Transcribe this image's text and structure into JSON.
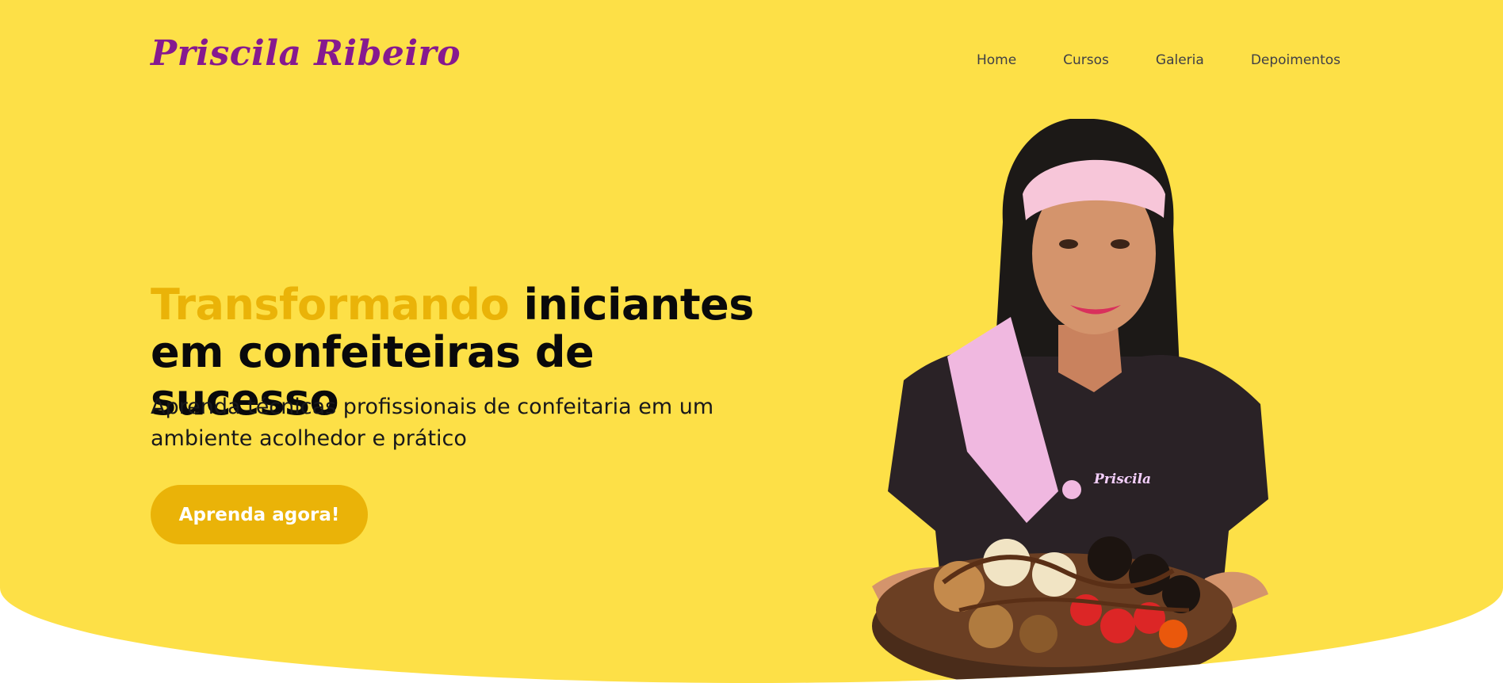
{
  "header": {
    "logo_text": "Priscila Ribeiro",
    "nav": [
      {
        "label": "Home"
      },
      {
        "label": "Cursos"
      },
      {
        "label": "Galeria"
      },
      {
        "label": "Depoimentos"
      }
    ]
  },
  "hero": {
    "headline_accent": "Transformando",
    "headline_rest_line1": "iniciantes",
    "headline_line2": "em confeiteiras de sucesso",
    "subtitle": "Aprenda técnicas profissionais de confeitaria em um ambiente acolhedor e prático",
    "cta_label": "Aprenda agora!",
    "photo_shirt_text": "Priscila"
  },
  "colors": {
    "background": "#fde047",
    "accent": "#eab308",
    "logo": "#86198f",
    "text": "#09090b"
  }
}
